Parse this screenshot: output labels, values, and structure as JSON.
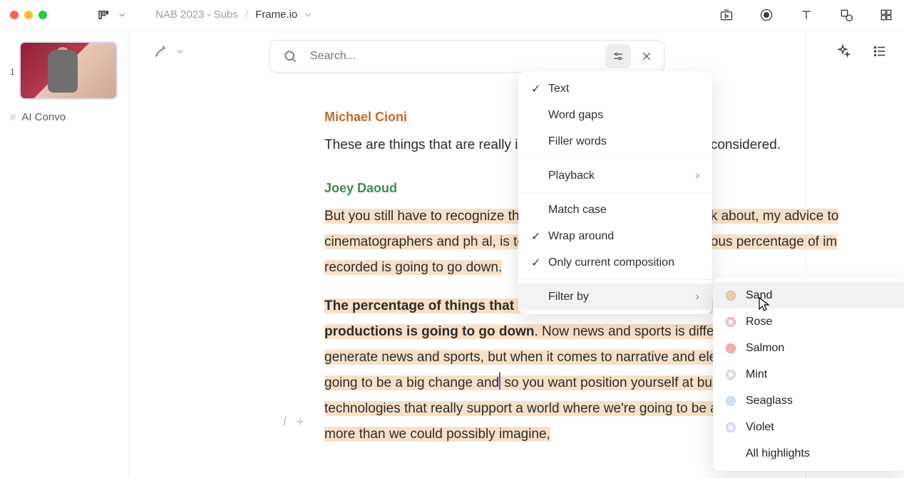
{
  "breadcrumb": {
    "project": "NAB 2023 - Subs",
    "file": "Frame.io"
  },
  "sidebar": {
    "page_number": "1",
    "tag_label": "AI Convo"
  },
  "search": {
    "placeholder": "Search..."
  },
  "transcript": {
    "speaker1_name": "Michael Cioni",
    "speaker1_text": "These are things that are really important to the Adob                                  things are considered.",
    "speaker2_name": "Joey Daoud",
    "speaker2_p1": "But you still have to recognize that this is an inevitabil                                has to think about, my advice to cinematographers and ph                                 al, is to really recognize that an enormous percentage of im                                  recorded is going to go down.",
    "speaker2_p2_bold": "The percentage of things that are photographed or recorded in the world for productions is going to go down",
    "speaker2_p2_rest_a": ". Now news and sports is different because you can't generate news and sports, but when it comes to narrative and elements like that there going to be a big change and",
    "speaker2_p2_rest_b": " so you want position yourself at businesses and compan and technologies that really support a world where we're going to be able to generate much more than we could possibly imagine,"
  },
  "menu": {
    "text": "Text",
    "word_gaps": "Word gaps",
    "filler_words": "Filler words",
    "playback": "Playback",
    "match_case": "Match case",
    "wrap_around": "Wrap around",
    "only_current": "Only current composition",
    "filter_by": "Filter by"
  },
  "colors": {
    "sand": "Sand",
    "rose": "Rose",
    "salmon": "Salmon",
    "mint": "Mint",
    "seaglass": "Seaglass",
    "violet": "Violet",
    "all": "All highlights"
  }
}
